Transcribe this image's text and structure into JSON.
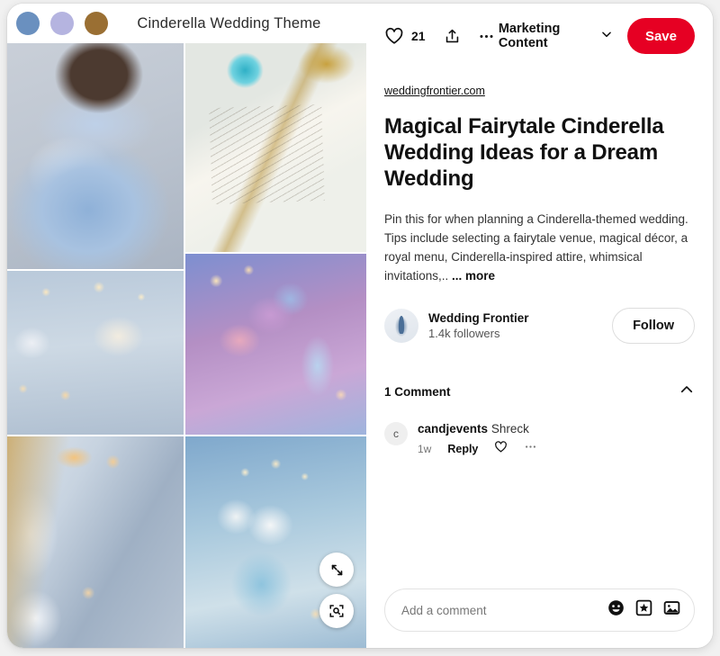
{
  "board": {
    "title": "Cinderella Wedding Theme",
    "swatches": [
      "#6a90bf",
      "#b5b4e0",
      "#9a6f33"
    ]
  },
  "gallery": {
    "images": [
      {
        "name": "blue-ball-gown-photo",
        "alt": "Bride in blue Cinderella ball gown"
      },
      {
        "name": "wedding-invitation-photo",
        "alt": "Blue and gold wedding invitation suite"
      },
      {
        "name": "reception-table-photo",
        "alt": "Candlelit reception table setting"
      },
      {
        "name": "glass-slipper-photo",
        "alt": "Glass slipper with roses centerpiece"
      },
      {
        "name": "wedding-cake-photo",
        "alt": "Blue and gold tiered wedding cake"
      },
      {
        "name": "blue-bouquet-photo",
        "alt": "White and blue floral bouquet"
      }
    ],
    "expand_icon": "expand-arrows-icon",
    "lens_icon": "visual-search-icon"
  },
  "actions": {
    "like_icon": "heart-icon",
    "like_count": "21",
    "share_icon": "share-icon",
    "more_icon": "ellipsis-icon",
    "board_name": "Marketing Content",
    "board_chevron": "chevron-down-icon",
    "save_label": "Save",
    "save_color": "#e60023"
  },
  "pin": {
    "source": "weddingfrontier.com",
    "title": "Magical Fairytale Cinderella Wedding Ideas for a Dream Wedding",
    "description": "Pin this for when planning a Cinderella-themed wedding. Tips include selecting a fairytale venue, magical décor, a royal menu, Cinderella-inspired attire, whimsical invitations,.. ",
    "more_label": "... more"
  },
  "profile": {
    "avatar_icon": "wedding-frontier-avatar",
    "name": "Wedding Frontier",
    "followers": "1.4k followers",
    "follow_label": "Follow"
  },
  "comments": {
    "count_label": "1 Comment",
    "collapse_icon": "chevron-up-icon",
    "items": [
      {
        "avatar_letter": "c",
        "username": "candjevents",
        "text": "Shreck",
        "time": "1w",
        "reply_label": "Reply",
        "like_icon": "heart-icon",
        "more_icon": "ellipsis-icon"
      }
    ]
  },
  "composer": {
    "placeholder": "Add a comment",
    "value": "",
    "emoji_icon": "emoji-icon",
    "sticker_icon": "sticker-icon",
    "image_icon": "image-icon"
  }
}
